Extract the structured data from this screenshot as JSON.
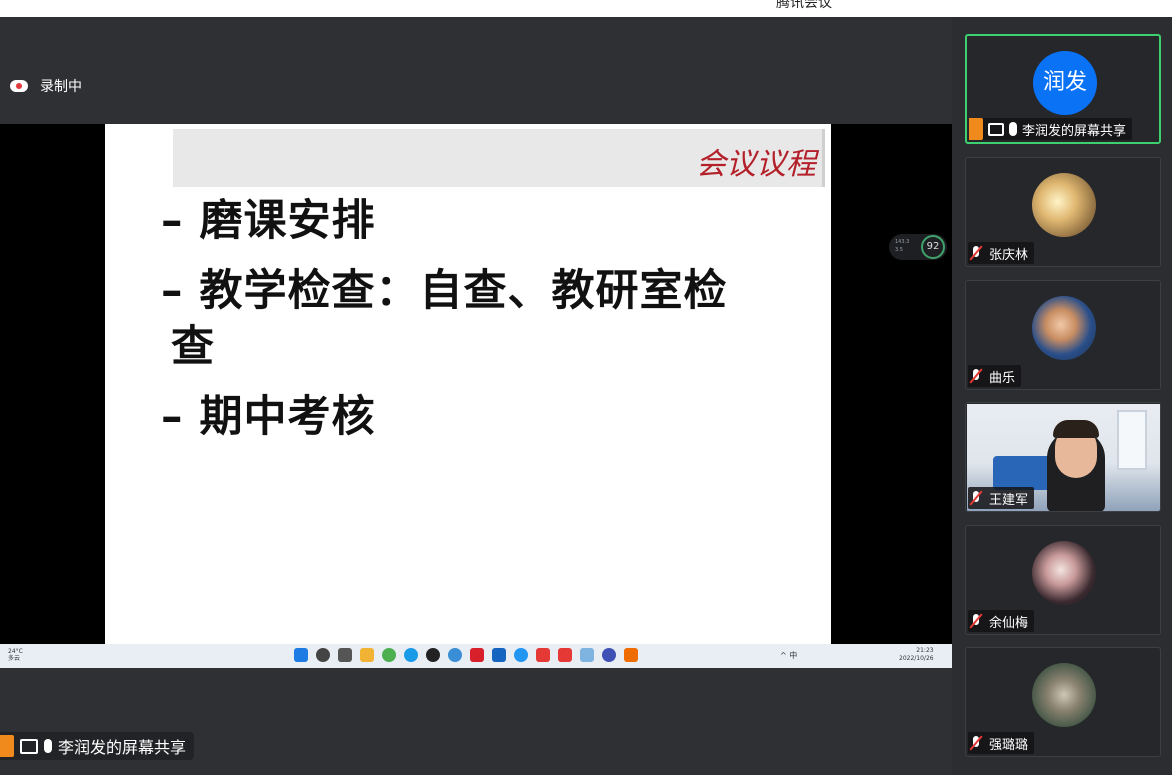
{
  "app": {
    "title": "腾讯会议"
  },
  "recording": {
    "label": "录制中"
  },
  "slide": {
    "header": "会议议程",
    "bullets": [
      "– 磨课安排",
      "– 教学检查：自查、教研室检",
      "查",
      "– 期中考核"
    ]
  },
  "network": {
    "up": "143.3",
    "down": "3.5",
    "cpu": "92"
  },
  "taskbar": {
    "weather_temp": "24°C",
    "weather_desc": "多云",
    "tray": "^ 中",
    "time": "21:23",
    "date": "2022/10/26"
  },
  "share_label": "李润发的屏幕共享",
  "participants": [
    {
      "name": "李润发的屏幕共享",
      "avatar_text": "润发",
      "active": true
    },
    {
      "name": "张庆林"
    },
    {
      "name": "曲乐"
    },
    {
      "name": "王建军"
    },
    {
      "name": "余仙梅"
    },
    {
      "name": "强璐璐"
    }
  ],
  "colors": {
    "accent_green": "#3ecf6e",
    "avatar_blue": "#0a72f5",
    "share_orange": "#f08a1c",
    "slide_title_red": "#b3202a"
  }
}
